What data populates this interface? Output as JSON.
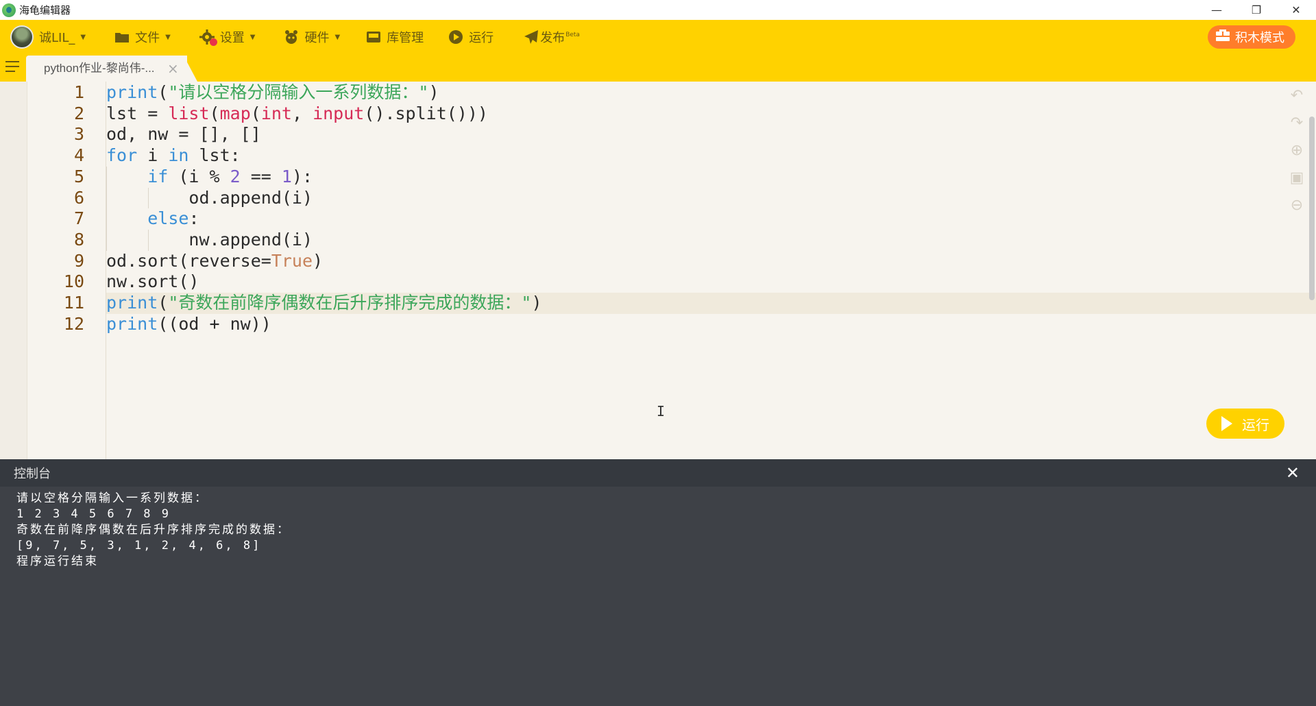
{
  "window": {
    "title": "海龟编辑器",
    "minimize_label": "—",
    "restore_label": "❐",
    "close_label": "✕"
  },
  "toolbar": {
    "user_name": "诚LIL_",
    "file_label": "文件",
    "settings_label": "设置",
    "hardware_label": "硬件",
    "library_label": "库管理",
    "run_label": "运行",
    "publish_label": "发布",
    "publish_badge": "Beta",
    "blocks_mode_label": "积木模式",
    "accent_color": "#ffd200"
  },
  "tabs": [
    {
      "label": "python作业-黎尚伟-...",
      "close": "×"
    }
  ],
  "editor": {
    "line_numbers": [
      "1",
      "2",
      "3",
      "4",
      "5",
      "6",
      "7",
      "8",
      "9",
      "10",
      "11",
      "12"
    ],
    "active_line": 11,
    "cursor_glyph": "I",
    "run_button_label": "运行"
  },
  "code_lines": [
    [
      [
        "fn-kw",
        "print"
      ],
      [
        "p",
        "("
      ],
      [
        "str",
        "\"请以空格分隔输入一系列数据：\""
      ],
      [
        "p",
        ")"
      ]
    ],
    [
      [
        "p",
        "lst = "
      ],
      [
        "fn",
        "list"
      ],
      [
        "p",
        "("
      ],
      [
        "fn",
        "map"
      ],
      [
        "p",
        "("
      ],
      [
        "fn",
        "int"
      ],
      [
        "p",
        ", "
      ],
      [
        "fn",
        "input"
      ],
      [
        "p",
        "().split()))"
      ]
    ],
    [
      [
        "p",
        "od, nw = [], []"
      ]
    ],
    [
      [
        "kw",
        "for"
      ],
      [
        "p",
        " i "
      ],
      [
        "kw",
        "in"
      ],
      [
        "p",
        " lst:"
      ]
    ],
    [
      [
        "p",
        "    "
      ],
      [
        "kw",
        "if"
      ],
      [
        "p",
        " (i % "
      ],
      [
        "num",
        "2"
      ],
      [
        "p",
        " == "
      ],
      [
        "num",
        "1"
      ],
      [
        "p",
        "):"
      ]
    ],
    [
      [
        "p",
        "        od.append(i)"
      ]
    ],
    [
      [
        "p",
        "    "
      ],
      [
        "kw",
        "else"
      ],
      [
        "p",
        ":"
      ]
    ],
    [
      [
        "p",
        "        nw.append(i)"
      ]
    ],
    [
      [
        "p",
        "od.sort(reverse="
      ],
      [
        "const",
        "True"
      ],
      [
        "p",
        ")"
      ]
    ],
    [
      [
        "p",
        "nw.sort()"
      ]
    ],
    [
      [
        "fn-kw",
        "print"
      ],
      [
        "p",
        "("
      ],
      [
        "str",
        "\"奇数在前降序偶数在后升序排序完成的数据：\""
      ],
      [
        "p",
        ")"
      ]
    ],
    [
      [
        "fn-kw",
        "print"
      ],
      [
        "p",
        "((od + nw))"
      ]
    ]
  ],
  "console": {
    "title": "控制台",
    "close": "✕",
    "lines": [
      "请以空格分隔输入一系列数据：",
      "1 2 3 4 5 6 7 8 9",
      "奇数在前降序偶数在后升序排序完成的数据：",
      "[9, 7, 5, 3, 1, 2, 4, 6, 8]",
      "程序运行结束"
    ]
  }
}
